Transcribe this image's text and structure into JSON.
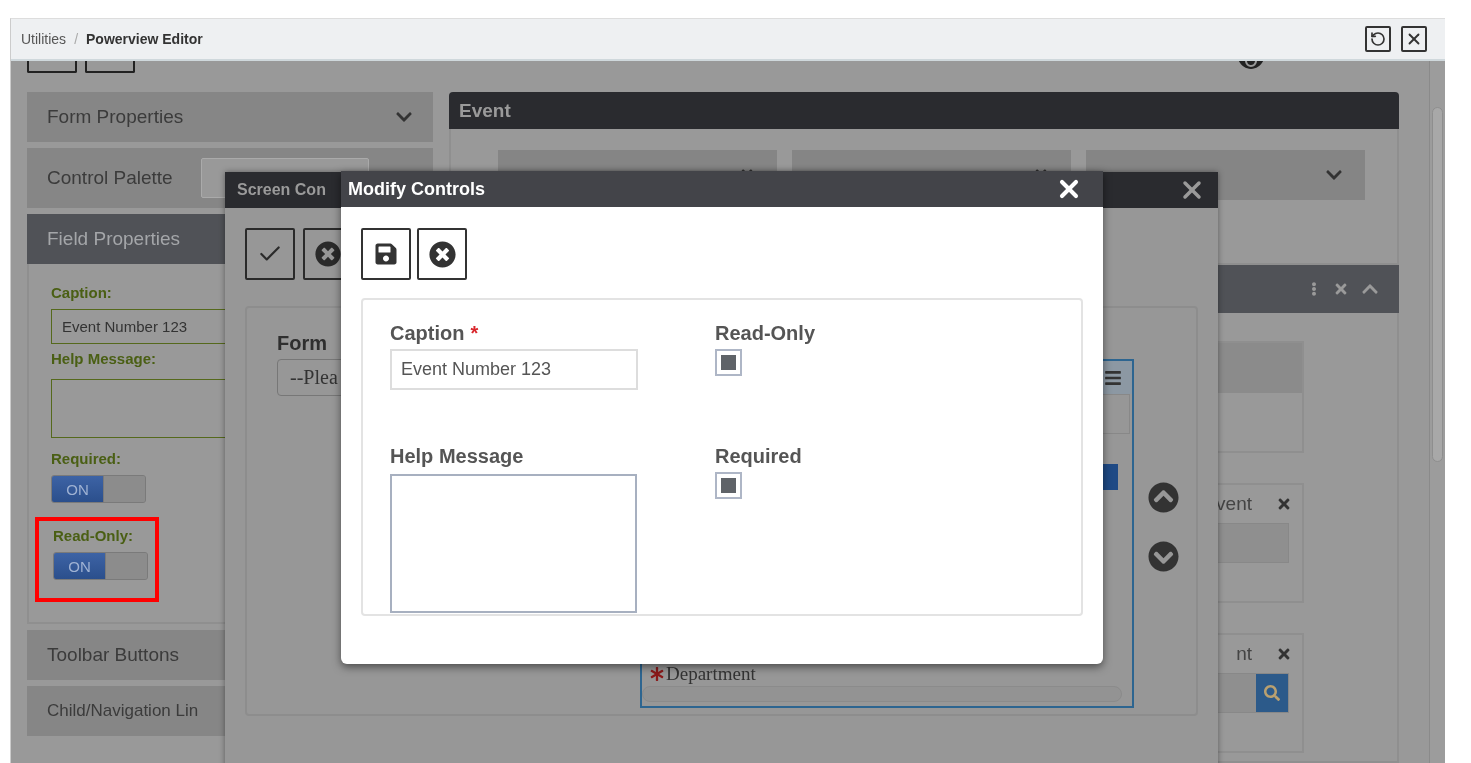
{
  "breadcrumb": {
    "items": [
      {
        "label": "Utilities",
        "selected": false
      },
      {
        "label": "Powerview Editor",
        "selected": true
      }
    ],
    "separator": "/"
  },
  "accordion": [
    {
      "title": "Form Properties",
      "kind": "chevron",
      "expanded": false
    },
    {
      "title": "Control Palette",
      "kind": "select",
      "expanded": false
    },
    {
      "title": "Field Properties",
      "kind": "plain",
      "expanded": true
    },
    {
      "title": "Toolbar Buttons",
      "kind": "plain",
      "expanded": false
    },
    {
      "title": "Child/Navigation Lin",
      "kind": "plain",
      "expanded": false
    }
  ],
  "field_properties": {
    "caption_label": "Caption:",
    "caption_value": "Event Number 123",
    "help_label": "Help Message:",
    "toggles": [
      {
        "label": "Required:",
        "text": "ON",
        "on": true,
        "highlighted": false
      },
      {
        "label": "Read-Only:",
        "text": "ON",
        "on": true,
        "highlighted": true
      }
    ]
  },
  "event_panel": {
    "title": "Event",
    "chips": [
      {
        "kind": "removable"
      },
      {
        "kind": "removable"
      },
      {
        "kind": "dropdown"
      }
    ]
  },
  "right_fields": [
    {
      "label": "vent",
      "kind": "text"
    },
    {
      "label": "nt",
      "kind": "lookup"
    }
  ],
  "screen_controls": {
    "title": "Screen Con",
    "form_label": "Form",
    "select_value": "--Plea",
    "list_items": [
      {
        "label": "Department",
        "kind": "required"
      }
    ]
  },
  "modify_controls": {
    "title": "Modify Controls",
    "fields": [
      {
        "label": "Caption",
        "required_mark": "*",
        "kind": "text",
        "value": "Event Number 123"
      },
      {
        "label": "Read-Only",
        "kind": "checkbox",
        "checked": true
      },
      {
        "label": "Help Message",
        "kind": "textarea"
      },
      {
        "label": "Required",
        "kind": "checkbox",
        "checked": true
      }
    ]
  }
}
